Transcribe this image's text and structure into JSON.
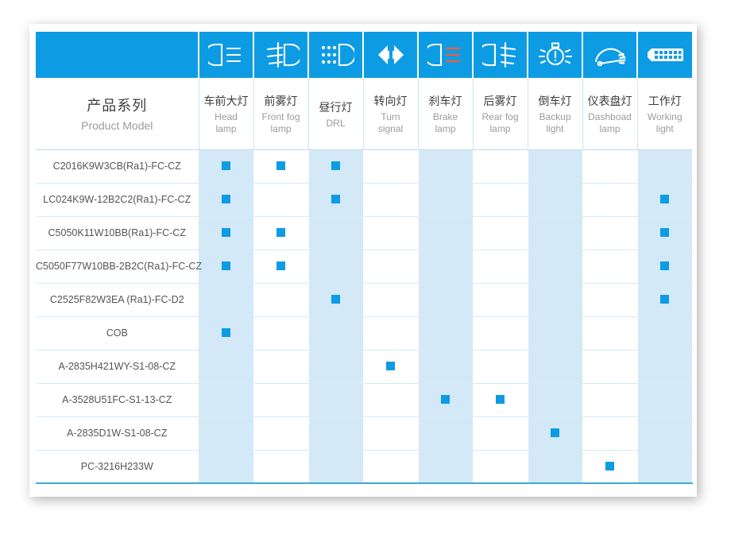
{
  "table": {
    "model_column": {
      "cn": "产品系列",
      "en": "Product Model"
    },
    "columns": [
      {
        "icon": "head-lamp-icon",
        "cn": "车前大灯",
        "en": "Head\nlamp"
      },
      {
        "icon": "front-fog-lamp-icon",
        "cn": "前雾灯",
        "en": "Front fog\nlamp"
      },
      {
        "icon": "drl-icon",
        "cn": "昼行灯",
        "en": "DRL"
      },
      {
        "icon": "turn-signal-icon",
        "cn": "转向灯",
        "en": "Turn\nsignal"
      },
      {
        "icon": "brake-lamp-icon",
        "cn": "刹车灯",
        "en": "Brake\nlamp"
      },
      {
        "icon": "rear-fog-lamp-icon",
        "cn": "后雾灯",
        "en": "Rear fog\nlamp"
      },
      {
        "icon": "backup-light-icon",
        "cn": "倒车灯",
        "en": "Backup\nlight"
      },
      {
        "icon": "dashboard-lamp-icon",
        "cn": "仪表盘灯",
        "en": "Dashboad\nlamp"
      },
      {
        "icon": "working-light-icon",
        "cn": "工作灯",
        "en": "Working\nlight"
      }
    ],
    "rows": [
      {
        "model": "C2016K9W3CB(Ra1)-FC-CZ",
        "marks": [
          1,
          1,
          1,
          0,
          0,
          0,
          0,
          0,
          0
        ]
      },
      {
        "model": "LC024K9W-12B2C2(Ra1)-FC-CZ",
        "marks": [
          1,
          0,
          1,
          0,
          0,
          0,
          0,
          0,
          1
        ]
      },
      {
        "model": "C5050K11W10BB(Ra1)-FC-CZ",
        "marks": [
          1,
          1,
          0,
          0,
          0,
          0,
          0,
          0,
          1
        ]
      },
      {
        "model": "C5050F77W10BB-2B2C(Ra1)-FC-CZ",
        "marks": [
          1,
          1,
          0,
          0,
          0,
          0,
          0,
          0,
          1
        ]
      },
      {
        "model": "C2525F82W3EA (Ra1)-FC-D2",
        "marks": [
          0,
          0,
          1,
          0,
          0,
          0,
          0,
          0,
          1
        ]
      },
      {
        "model": "COB",
        "marks": [
          1,
          0,
          0,
          0,
          0,
          0,
          0,
          0,
          0
        ]
      },
      {
        "model": "A-2835H421WY-S1-08-CZ",
        "marks": [
          0,
          0,
          0,
          1,
          0,
          0,
          0,
          0,
          0
        ]
      },
      {
        "model": "A-3528U51FC-S1-13-CZ",
        "marks": [
          0,
          0,
          0,
          0,
          1,
          1,
          0,
          0,
          0
        ]
      },
      {
        "model": "A-2835D1W-S1-08-CZ",
        "marks": [
          0,
          0,
          0,
          0,
          0,
          0,
          1,
          0,
          0
        ]
      },
      {
        "model": "PC-3216H233W",
        "marks": [
          0,
          0,
          0,
          0,
          0,
          0,
          0,
          1,
          0
        ]
      }
    ]
  },
  "colors": {
    "header_blue": "#0d9ce4",
    "column_shade": "#d4e9f7",
    "mark_blue": "#0d9ce4",
    "bottom_rule": "#3fa9d8",
    "brake_red": "#e2604a"
  }
}
